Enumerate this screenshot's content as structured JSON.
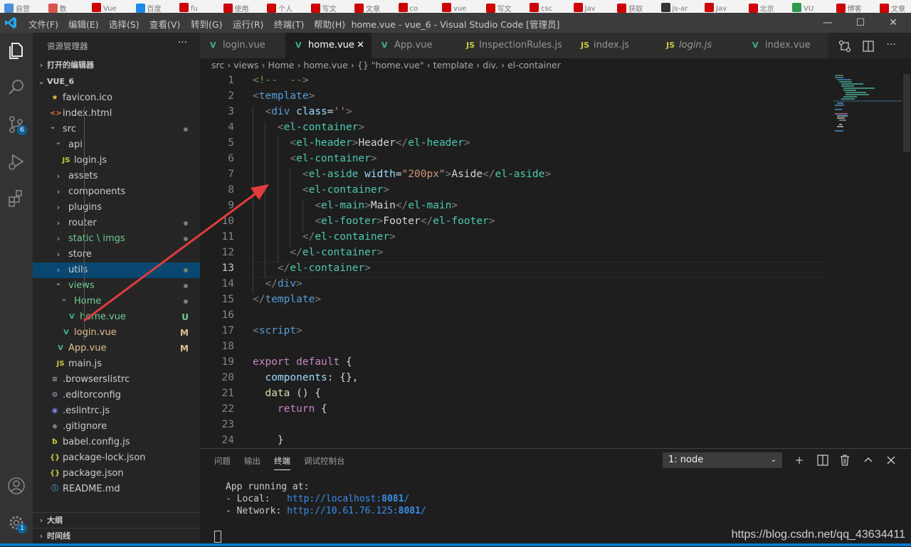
{
  "bookmarks": [
    "自营",
    "数",
    "Vue",
    "百度",
    "fu",
    "使用",
    "个人",
    "写文",
    "文章",
    "co",
    "vue",
    "写文",
    "csc",
    "Jav",
    "获取",
    "js-ar",
    "Jav",
    "北京",
    "VU",
    "博客",
    "文章"
  ],
  "menu": [
    "文件(F)",
    "编辑(E)",
    "选择(S)",
    "查看(V)",
    "转到(G)",
    "运行(R)",
    "终端(T)",
    "帮助(H)"
  ],
  "window_title": "home.vue - vue_6 - Visual Studio Code [管理员]",
  "window_buttons": [
    "—",
    "☐",
    "✕"
  ],
  "activity": {
    "scm_badge": "6",
    "settings_badge": "1"
  },
  "sidebar": {
    "title": "资源管理器",
    "more": "···",
    "open_editors": "打开的编辑器",
    "project": "VUE_6",
    "outline": "大纲",
    "timeline": "时间线",
    "tree": [
      {
        "label": "favicon.ico",
        "icon": "★",
        "icon_color": "#e8c14b",
        "depth": 1
      },
      {
        "label": "index.html",
        "icon": "<>",
        "icon_color": "#e37933",
        "depth": 1
      },
      {
        "label": "src",
        "chev": "v",
        "depth": 1,
        "dot": true
      },
      {
        "label": "api",
        "chev": "v",
        "depth": 2
      },
      {
        "label": "login.js",
        "icon": "JS",
        "icon_color": "#cbcb41",
        "depth": 3
      },
      {
        "label": "assets",
        "chev": ">",
        "depth": 2
      },
      {
        "label": "components",
        "chev": ">",
        "depth": 2
      },
      {
        "label": "plugins",
        "chev": ">",
        "depth": 2
      },
      {
        "label": "router",
        "chev": ">",
        "depth": 2,
        "dot": true
      },
      {
        "label": "static \\ imgs",
        "chev": ">",
        "depth": 2,
        "dot": true,
        "color": "#73c991"
      },
      {
        "label": "store",
        "chev": ">",
        "depth": 2
      },
      {
        "label": "utils",
        "chev": ">",
        "depth": 2,
        "dot": true,
        "selected": true
      },
      {
        "label": "views",
        "chev": "v",
        "depth": 2,
        "dot": true,
        "color": "#73c991"
      },
      {
        "label": "Home",
        "chev": "v",
        "depth": 3,
        "dot": true,
        "color": "#73c991"
      },
      {
        "label": "home.vue",
        "icon": "V",
        "icon_color": "#41b883",
        "depth": 4,
        "status": "U",
        "color": "#73c991"
      },
      {
        "label": "login.vue",
        "icon": "V",
        "icon_color": "#41b883",
        "depth": 3,
        "status": "M",
        "color": "#e2c08d"
      },
      {
        "label": "App.vue",
        "icon": "V",
        "icon_color": "#41b883",
        "depth": 2,
        "status": "M",
        "color": "#e2c08d"
      },
      {
        "label": "main.js",
        "icon": "JS",
        "icon_color": "#cbcb41",
        "depth": 2
      },
      {
        "label": ".browserslistrc",
        "icon": "≡",
        "icon_color": "#9da5b4",
        "depth": 1
      },
      {
        "label": ".editorconfig",
        "icon": "⚙",
        "icon_color": "#9da5b4",
        "depth": 1
      },
      {
        "label": ".eslintrc.js",
        "icon": "◉",
        "icon_color": "#8080f0",
        "depth": 1
      },
      {
        "label": ".gitignore",
        "icon": "◆",
        "icon_color": "#6d8086",
        "depth": 1
      },
      {
        "label": "babel.config.js",
        "icon": "ƀ",
        "icon_color": "#cbcb41",
        "depth": 1
      },
      {
        "label": "package-lock.json",
        "icon": "{}",
        "icon_color": "#cbcb41",
        "depth": 1
      },
      {
        "label": "package.json",
        "icon": "{}",
        "icon_color": "#cbcb41",
        "depth": 1
      },
      {
        "label": "README.md",
        "icon": "ⓘ",
        "icon_color": "#519aba",
        "depth": 1
      }
    ]
  },
  "tabs": [
    {
      "label": "login.vue",
      "icon": "V",
      "icon_color": "#41b883"
    },
    {
      "label": "home.vue",
      "icon": "V",
      "icon_color": "#41b883",
      "active": true
    },
    {
      "label": "App.vue",
      "icon": "V",
      "icon_color": "#41b883"
    },
    {
      "label": "InspectionRules.js",
      "icon": "JS",
      "icon_color": "#cbcb41"
    },
    {
      "label": "index.js",
      "icon": "JS",
      "icon_color": "#cbcb41"
    },
    {
      "label": "login.js",
      "icon": "JS",
      "icon_color": "#cbcb41",
      "italic": true
    },
    {
      "label": "index.vue",
      "icon": "V",
      "icon_color": "#41b883"
    }
  ],
  "tab_close": "✕",
  "breadcrumb": [
    "src",
    "views",
    "Home",
    "home.vue",
    "{} \"home.vue\"",
    "template",
    "div.",
    "el-container"
  ],
  "line_numbers": [
    "1",
    "2",
    "3",
    "4",
    "5",
    "6",
    "7",
    "8",
    "9",
    "10",
    "11",
    "12",
    "13",
    "14",
    "15",
    "16",
    "17",
    "18",
    "19",
    "20",
    "21",
    "22",
    "23",
    "24"
  ],
  "code_lines": [
    [
      [
        "c-cmt",
        "<!--  -->"
      ]
    ],
    [
      [
        "c-punc",
        "<"
      ],
      [
        "c-tag",
        "template"
      ],
      [
        "c-punc",
        ">"
      ]
    ],
    [
      [
        "c-txt",
        "  "
      ],
      [
        "c-punc",
        "<"
      ],
      [
        "c-tag",
        "div"
      ],
      [
        "c-txt",
        " "
      ],
      [
        "c-attr",
        "class"
      ],
      [
        "c-txt",
        "="
      ],
      [
        "c-str",
        "''"
      ],
      [
        "c-punc",
        ">"
      ]
    ],
    [
      [
        "c-txt",
        "    "
      ],
      [
        "c-punc",
        "<"
      ],
      [
        "c-tag2",
        "el-container"
      ],
      [
        "c-punc",
        ">"
      ]
    ],
    [
      [
        "c-txt",
        "      "
      ],
      [
        "c-punc",
        "<"
      ],
      [
        "c-tag2",
        "el-header"
      ],
      [
        "c-punc",
        ">"
      ],
      [
        "c-txt",
        "Header"
      ],
      [
        "c-punc",
        "</"
      ],
      [
        "c-tag2",
        "el-header"
      ],
      [
        "c-punc",
        ">"
      ]
    ],
    [
      [
        "c-txt",
        "      "
      ],
      [
        "c-punc",
        "<"
      ],
      [
        "c-tag2",
        "el-container"
      ],
      [
        "c-punc",
        ">"
      ]
    ],
    [
      [
        "c-txt",
        "        "
      ],
      [
        "c-punc",
        "<"
      ],
      [
        "c-tag2",
        "el-aside"
      ],
      [
        "c-txt",
        " "
      ],
      [
        "c-attr",
        "width"
      ],
      [
        "c-txt",
        "="
      ],
      [
        "c-str",
        "\"200px\""
      ],
      [
        "c-punc",
        ">"
      ],
      [
        "c-txt",
        "Aside"
      ],
      [
        "c-punc",
        "</"
      ],
      [
        "c-tag2",
        "el-aside"
      ],
      [
        "c-punc",
        ">"
      ]
    ],
    [
      [
        "c-txt",
        "        "
      ],
      [
        "c-punc",
        "<"
      ],
      [
        "c-tag2",
        "el-container"
      ],
      [
        "c-punc",
        ">"
      ]
    ],
    [
      [
        "c-txt",
        "          "
      ],
      [
        "c-punc",
        "<"
      ],
      [
        "c-tag2",
        "el-main"
      ],
      [
        "c-punc",
        ">"
      ],
      [
        "c-txt",
        "Main"
      ],
      [
        "c-punc",
        "</"
      ],
      [
        "c-tag2",
        "el-main"
      ],
      [
        "c-punc",
        ">"
      ]
    ],
    [
      [
        "c-txt",
        "          "
      ],
      [
        "c-punc",
        "<"
      ],
      [
        "c-tag2",
        "el-footer"
      ],
      [
        "c-punc",
        ">"
      ],
      [
        "c-txt",
        "Footer"
      ],
      [
        "c-punc",
        "</"
      ],
      [
        "c-tag2",
        "el-footer"
      ],
      [
        "c-punc",
        ">"
      ]
    ],
    [
      [
        "c-txt",
        "        "
      ],
      [
        "c-punc",
        "</"
      ],
      [
        "c-tag2",
        "el-container"
      ],
      [
        "c-punc",
        ">"
      ]
    ],
    [
      [
        "c-txt",
        "      "
      ],
      [
        "c-punc",
        "</"
      ],
      [
        "c-tag2",
        "el-container"
      ],
      [
        "c-punc",
        ">"
      ]
    ],
    [
      [
        "c-txt",
        "    "
      ],
      [
        "c-punc",
        "</"
      ],
      [
        "c-tag2",
        "el-container"
      ],
      [
        "c-punc",
        ">"
      ]
    ],
    [
      [
        "c-txt",
        "  "
      ],
      [
        "c-punc",
        "</"
      ],
      [
        "c-tag",
        "div"
      ],
      [
        "c-punc",
        ">"
      ]
    ],
    [
      [
        "c-punc",
        "</"
      ],
      [
        "c-tag",
        "template"
      ],
      [
        "c-punc",
        ">"
      ]
    ],
    [],
    [
      [
        "c-punc",
        "<"
      ],
      [
        "c-tag",
        "script"
      ],
      [
        "c-punc",
        ">"
      ]
    ],
    [],
    [
      [
        "c-kw",
        "export"
      ],
      [
        "c-txt",
        " "
      ],
      [
        "c-kw",
        "default"
      ],
      [
        "c-txt",
        " {"
      ]
    ],
    [
      [
        "c-txt",
        "  "
      ],
      [
        "c-var",
        "components"
      ],
      [
        "c-txt",
        ": {},"
      ]
    ],
    [
      [
        "c-txt",
        "  "
      ],
      [
        "c-fn",
        "data"
      ],
      [
        "c-txt",
        " () {"
      ]
    ],
    [
      [
        "c-txt",
        "    "
      ],
      [
        "c-kw",
        "return"
      ],
      [
        "c-txt",
        " {"
      ]
    ],
    [],
    [
      [
        "c-txt",
        "    }"
      ]
    ]
  ],
  "current_line_index": 12,
  "panel": {
    "tabs": [
      "问题",
      "输出",
      "终端",
      "调试控制台"
    ],
    "active_tab": 2,
    "terminal_select": "1: node",
    "actions": [
      "+",
      "◫",
      "🗑",
      "^",
      "✕"
    ],
    "output": {
      "line1": "App running at:",
      "local_prefix": "- Local:   ",
      "local_url": "http://localhost:",
      "local_port": "8081",
      "local_slash": "/",
      "net_prefix": "- Network: ",
      "net_url": "http://10.61.76.125:",
      "net_port": "8081",
      "net_slash": "/"
    }
  },
  "watermark": "https://blog.csdn.net/qq_43634411",
  "colors": {
    "accent": "#007acc",
    "arrow": "#e23c3c",
    "git_untracked": "#73c991",
    "git_modified": "#e2c08d"
  }
}
